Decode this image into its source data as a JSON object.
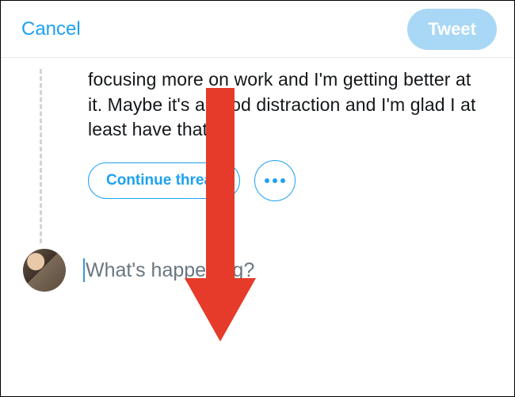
{
  "header": {
    "cancel_label": "Cancel",
    "tweet_label": "Tweet"
  },
  "thread": {
    "previous_text": "focusing more on work and I'm getting better at it. Maybe it's a good distraction and I'm glad I at least have that.",
    "continue_label": "Continue thread"
  },
  "compose": {
    "placeholder": "What's happening?",
    "value": ""
  },
  "icons": {
    "more": "more-options-icon",
    "avatar": "user-avatar"
  },
  "annotation": {
    "arrow": "scroll-down-arrow",
    "color": "#e63b2a"
  }
}
